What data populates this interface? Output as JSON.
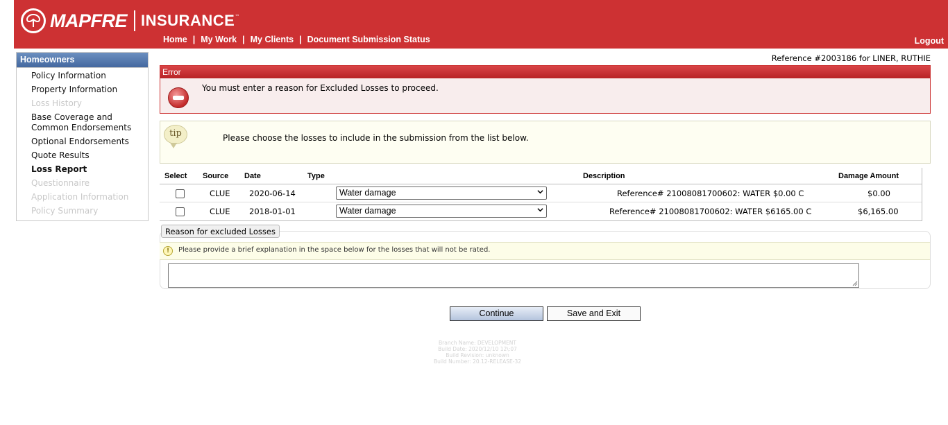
{
  "header": {
    "brand": "MAPFRE",
    "product": "INSURANCE",
    "trademark": "™",
    "brand_color": "#cd3133",
    "nav": [
      {
        "label": "Home"
      },
      {
        "label": "My Work"
      },
      {
        "label": "My Clients"
      },
      {
        "label": "Document Submission Status"
      }
    ],
    "nav_separator": "|",
    "logout_label": "Logout"
  },
  "sidebar": {
    "title": "Homeowners",
    "items": [
      {
        "label": "Policy Information",
        "state": "enabled"
      },
      {
        "label": "Property Information",
        "state": "enabled"
      },
      {
        "label": "Loss History",
        "state": "disabled"
      },
      {
        "label": "Base Coverage and Common Endorsements",
        "state": "enabled"
      },
      {
        "label": "Optional Endorsements",
        "state": "enabled"
      },
      {
        "label": "Quote Results",
        "state": "enabled"
      },
      {
        "label": "Loss Report",
        "state": "active"
      },
      {
        "label": "Questionnaire",
        "state": "disabled"
      },
      {
        "label": "Application Information",
        "state": "disabled"
      },
      {
        "label": "Policy Summary",
        "state": "disabled"
      }
    ]
  },
  "reference_text": "Reference #2003186 for LINER, RUTHIE",
  "error": {
    "title": "Error",
    "message": "You must enter a reason for Excluded Losses to proceed.",
    "icon": "stop-icon"
  },
  "tip": {
    "icon_label": "tip",
    "message": "Please choose the losses to include in the submission from the list below."
  },
  "loss_table": {
    "headers": {
      "select": "Select",
      "source": "Source",
      "date": "Date",
      "type": "Type",
      "description": "Description",
      "amount": "Damage Amount"
    },
    "rows": [
      {
        "selected": false,
        "source": "CLUE",
        "date": "2020-06-14",
        "type": "Water damage",
        "description": "Reference# 21008081700602: WATER $0.00 C",
        "amount": "$0.00"
      },
      {
        "selected": false,
        "source": "CLUE",
        "date": "2018-01-01",
        "type": "Water damage",
        "description": "Reference# 21008081700602: WATER $6165.00 C",
        "amount": "$6,165.00"
      }
    ]
  },
  "reason": {
    "legend": "Reason for excluded Losses",
    "hint_icon": "!",
    "hint": "Please provide a brief explanation in the space below for the losses that will not be rated.",
    "value": ""
  },
  "buttons": {
    "continue_label": "Continue",
    "save_exit_label": "Save and Exit"
  },
  "build_info": {
    "branch": "Branch Name: DEVELOPMENT",
    "date": "Build Date: 2020/12/10 12\\:07",
    "revision": "Build Revision: unknown",
    "number": "Build Number: 20.12-RELEASE-32"
  }
}
